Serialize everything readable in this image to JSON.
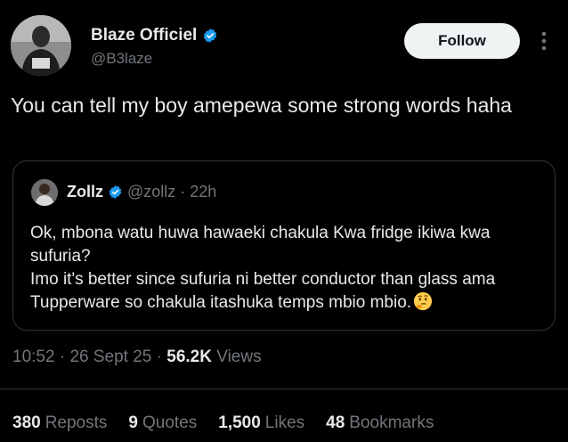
{
  "author": {
    "display_name": "Blaze Officiel",
    "handle": "@B3laze",
    "verified": true
  },
  "follow_button": {
    "label": "Follow"
  },
  "more_menu": {
    "icon": "more-vertical-icon"
  },
  "tweet": {
    "text": "You can tell my boy amepewa some strong words haha"
  },
  "quoted_tweet": {
    "display_name": "Zollz",
    "verified": true,
    "handle": "@zollz",
    "separator": "·",
    "time": "22h",
    "text_line1": "Ok, mbona watu huwa hawaeki chakula Kwa fridge ikiwa kwa sufuria?",
    "text_line2": "Imo it's better since sufuria ni better conductor than glass ama Tupperware so chakula itashuka temps mbio mbio.",
    "emoji": "thinking-face-icon"
  },
  "meta": {
    "time": "10:52",
    "separator": "·",
    "date": "26 Sept 25",
    "views_count": "56.2K",
    "views_label": "Views"
  },
  "stats": {
    "reposts_count": "380",
    "reposts_label": "Reposts",
    "quotes_count": "9",
    "quotes_label": "Quotes",
    "likes_count": "1,500",
    "likes_label": "Likes",
    "bookmarks_count": "48",
    "bookmarks_label": "Bookmarks"
  },
  "colors": {
    "background": "#000000",
    "text_primary": "#e7e9ea",
    "text_secondary": "#71767b",
    "verified_badge": "#1d9bf0",
    "follow_button_bg": "#eff3f4",
    "border": "#2f3336"
  }
}
